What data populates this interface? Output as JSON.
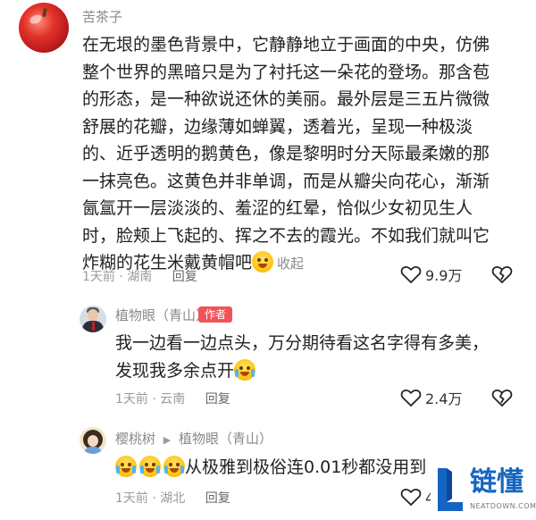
{
  "comments": [
    {
      "username": "苦茶子",
      "body_lines": [
        "在无垠的墨色背景中，它静静地立于画面的中央，仿佛",
        "整个世界的黑暗只是为了衬托这一朵花的登场。那含苞",
        "的形态，是一种欲说还休的美丽。最外层是三五片微微",
        "舒展的花瓣，边缘薄如蝉翼，透着光，呈现一种极淡",
        "的、近乎透明的鹅黄色，像是黎明时分天际最柔嫩的那",
        "一抹亮色。这黄色并非单调，而是从瓣尖向花心，渐渐",
        "氤氲开一层淡淡的、羞涩的红晕，恰似少女初见生人",
        "时，脸颊上飞起的、挥之不去的霞光。不如我们就叫它",
        "炸糊的花生米戴黄帽吧"
      ],
      "collapse_label": "收起",
      "time": "1天前",
      "location": "湖南",
      "reply_label": "回复",
      "likes": "9.9万",
      "emoji": "smiling-emoji"
    },
    {
      "username": "植物眼（青山）",
      "author_tag": "作者",
      "body_lines": [
        "我一边看一边点头，万分期待看这名字得有多美，",
        "发现我多余点开"
      ],
      "time": "1天前",
      "location": "云南",
      "reply_label": "回复",
      "likes": "2.4万",
      "emoji": "crying-laughing-emoji"
    },
    {
      "username": "樱桃树",
      "reply_to": "植物眼（青山）",
      "body_text": "从极雅到极俗连0.01秒都没用到",
      "time": "1天前",
      "location": "湖北",
      "reply_label": "回复",
      "likes": "4",
      "emoji": "crying-laughing-emoji"
    }
  ],
  "meta_separator": "·",
  "watermark": {
    "brand": "链懂",
    "site": "NEATDOWN.COM"
  },
  "colors": {
    "author_tag": "#f05458",
    "watermark": "#1565c0",
    "meta": "#9a9a9a"
  }
}
